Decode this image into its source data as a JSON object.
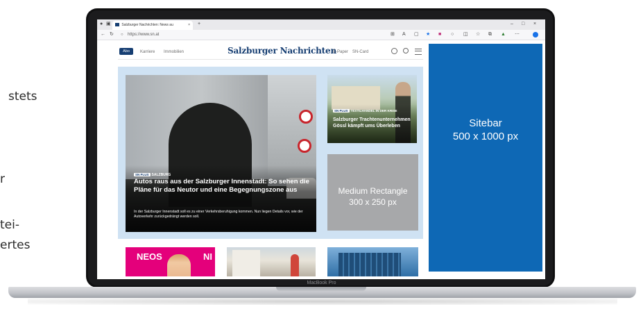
{
  "side_text": [
    "stets",
    "r",
    "tei-",
    "ertes"
  ],
  "laptop": {
    "model": "MacBook Pro"
  },
  "browser": {
    "tab_title": "Salzburger Nachrichten: News au",
    "url": "https://www.sn.at",
    "window_controls": [
      "–",
      "□",
      "×"
    ]
  },
  "site": {
    "abo_label": "Abo",
    "nav_left": [
      "Karriere",
      "Immobilien"
    ],
    "logo": "Salzburger Nachrichten",
    "nav_right": [
      "E-Paper",
      "SN-Card"
    ],
    "icons": [
      "user-icon",
      "search-icon",
      "menu-icon"
    ],
    "hero": {
      "badge": "SN PLUS",
      "kicker": "SALZBURG",
      "headline": "Autos raus aus der Salzburger Innenstadt: So sehen die Pläne für das Neutor und eine Begegnungszone aus",
      "teaser": "In der Salzburger Innenstadt soll es zu einer Verkehrsberuhigung kommen. Nun liegen Details vor, wie der Autoverkehr zurückgedrängt werden soll."
    },
    "side_article": {
      "badge": "SN PLUS",
      "kicker": "TEXTILHANDEL IN DER KRISE",
      "headline": "Salzburger Trachtenunternehmen Gössl kämpft ums Überleben"
    },
    "medium_rectangle": {
      "line1": "Medium Rectangle",
      "line2": "300 x 250 px"
    },
    "sitebar": {
      "line1": "Sitebar",
      "line2": "500 x 1000 px",
      "color": "#0e68b5"
    },
    "thumb_text": {
      "neos": "NEOS",
      "n": "NI"
    }
  }
}
